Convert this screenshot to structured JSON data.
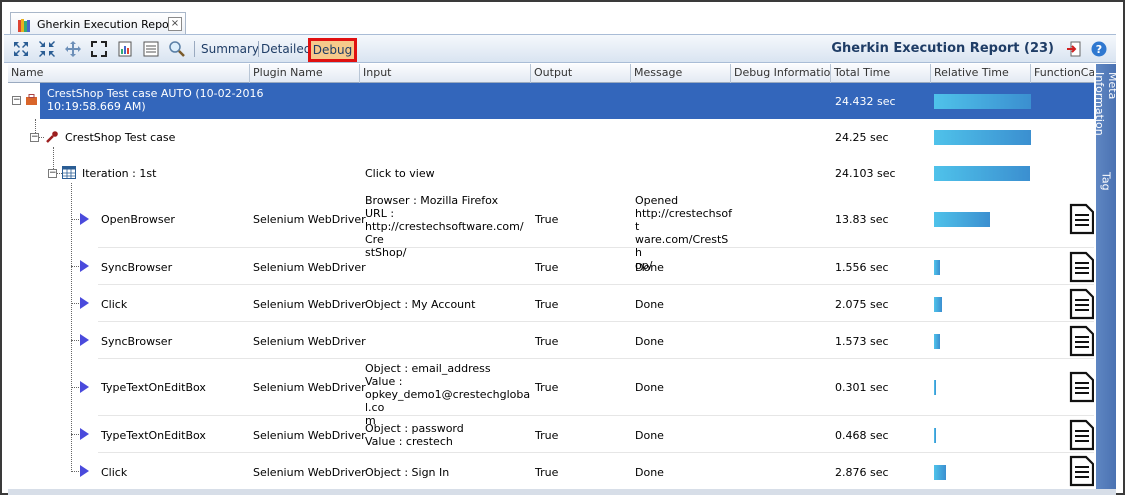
{
  "tab": {
    "label": "Gherkin Execution Report",
    "close": "×"
  },
  "toolbar": {
    "summary": "Summary",
    "detailed": "Detailed",
    "debug": "Debug",
    "report_title": "Gherkin Execution Report (23)"
  },
  "columns": [
    "Name",
    "Plugin Name",
    "Input",
    "Output",
    "Message",
    "Debug Information",
    "Total Time",
    "Relative Time",
    "FunctionCall"
  ],
  "side_tabs": [
    "Meta Information",
    "Tag"
  ],
  "rows": {
    "r0": {
      "name": "CrestShop Test case AUTO (10-02-2016\n10:19:58.669 AM)",
      "total": "24.432 sec",
      "rel": 0.99
    },
    "r1": {
      "name": "CrestShop Test case",
      "total": "24.25 sec",
      "rel": 0.99
    },
    "r2": {
      "name": "Iteration : 1st",
      "input": "Click to view",
      "total": "24.103 sec",
      "rel": 0.98
    },
    "r3": {
      "name": "OpenBrowser",
      "plugin": "Selenium WebDriver",
      "input": "Browser : Mozilla Firefox\nURL :\nhttp://crestechsoftware.com/Cre\nstShop/",
      "output": "True",
      "message": "Opened\nhttp://crestechsoft\nware.com/CrestSh\nop/",
      "total": "13.83 sec",
      "rel": 0.57
    },
    "r4": {
      "name": "SyncBrowser",
      "plugin": "Selenium WebDriver",
      "input": "",
      "output": "True",
      "message": "Done",
      "total": "1.556 sec",
      "rel": 0.065
    },
    "r5": {
      "name": "Click",
      "plugin": "Selenium WebDriver",
      "input": "Object : My Account",
      "output": "True",
      "message": "Done",
      "total": "2.075 sec",
      "rel": 0.085
    },
    "r6": {
      "name": "SyncBrowser",
      "plugin": "Selenium WebDriver",
      "input": "",
      "output": "True",
      "message": "Done",
      "total": "1.573 sec",
      "rel": 0.065
    },
    "r7": {
      "name": "TypeTextOnEditBox",
      "plugin": "Selenium WebDriver",
      "input": "Object : email_address\nValue :\nopkey_demo1@crestechglobal.co\nm",
      "output": "True",
      "message": "Done",
      "total": "0.301 sec",
      "rel": 0.012
    },
    "r8": {
      "name": "TypeTextOnEditBox",
      "plugin": "Selenium WebDriver",
      "input": "Object : password\nValue : crestech",
      "output": "True",
      "message": "Done",
      "total": "0.468 sec",
      "rel": 0.019
    },
    "r9": {
      "name": "Click",
      "plugin": "Selenium WebDriver",
      "input": "Object : Sign In",
      "output": "True",
      "message": "Done",
      "total": "2.876 sec",
      "rel": 0.118
    }
  },
  "colors": {
    "selected_row": "#3366bb",
    "bar": "#3b8fd0",
    "debug_highlight": "#e01010",
    "header_text": "#1f3d66"
  }
}
